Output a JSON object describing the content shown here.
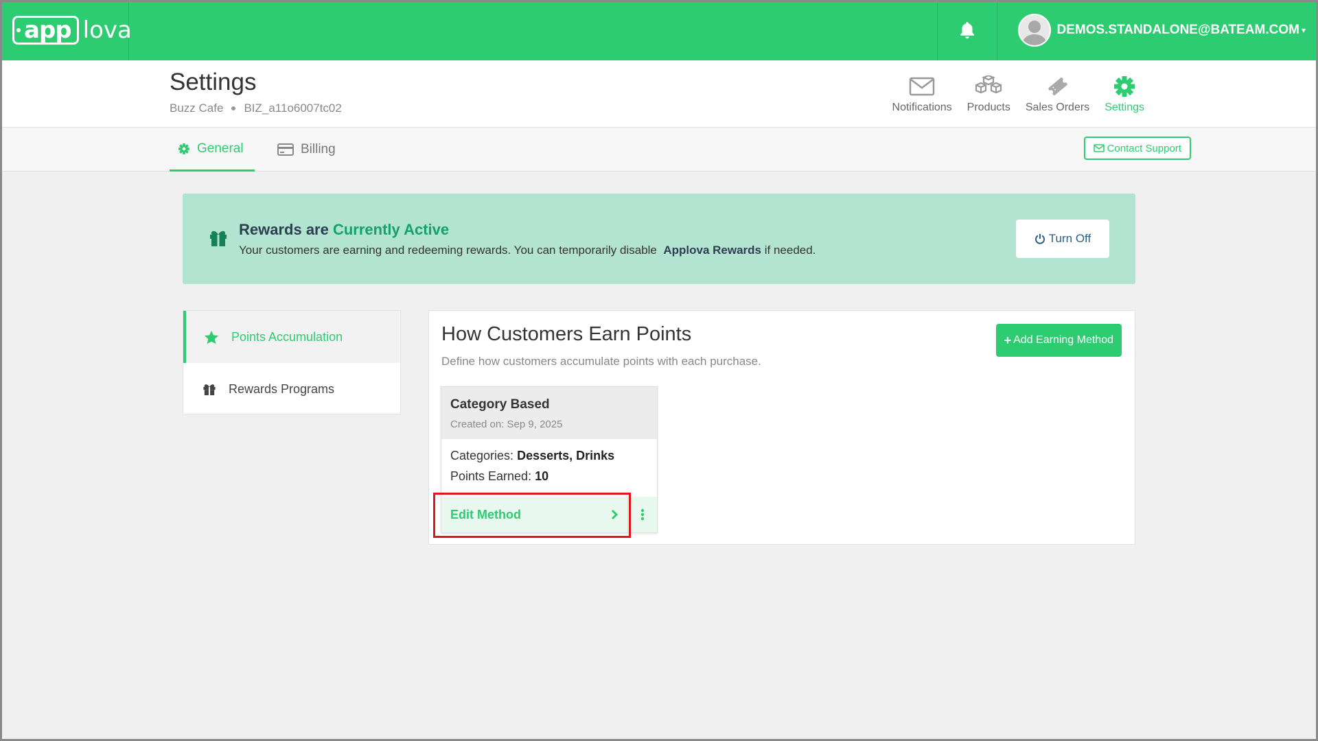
{
  "app": {
    "logo_main": "app",
    "logo_rest": "lova",
    "user_email": "DEMOS.STANDALONE@BATEAM.COM"
  },
  "header": {
    "title": "Settings",
    "business_name": "Buzz Cafe",
    "business_id": "BIZ_a11o6007tc02",
    "nav": [
      {
        "label": "Notifications",
        "icon": "envelope-icon"
      },
      {
        "label": "Products",
        "icon": "boxes-icon"
      },
      {
        "label": "Sales Orders",
        "icon": "ticket-icon"
      },
      {
        "label": "Settings",
        "icon": "gear-icon",
        "active": true
      }
    ]
  },
  "tabs": [
    {
      "label": "General",
      "icon": "gear-icon",
      "active": true
    },
    {
      "label": "Billing",
      "icon": "credit-card-icon"
    }
  ],
  "contact_support": "Contact Support",
  "banner": {
    "title_prefix": "Rewards are",
    "title_status": "Currently Active",
    "text_before": "Your customers are earning and redeeming rewards. You can temporarily disable",
    "text_brand": "Applova Rewards",
    "text_after": "if needed.",
    "button": "Turn Off"
  },
  "leftmenu": [
    {
      "label": "Points Accumulation",
      "icon": "star-icon",
      "active": true
    },
    {
      "label": "Rewards Programs",
      "icon": "gift-icon"
    }
  ],
  "panel": {
    "title": "How Customers Earn Points",
    "description": "Define how customers accumulate points with each purchase.",
    "add_button": "Add Earning Method"
  },
  "card": {
    "name": "Category Based",
    "created": "Created on: Sep 9, 2025",
    "categories_label": "Categories:",
    "categories_value": "Desserts, Drinks",
    "points_label": "Points Earned:",
    "points_value": "10",
    "edit_label": "Edit Method"
  },
  "colors": {
    "brand": "#2ecc71",
    "banner_bg": "#b3e4d1",
    "highlight": "#e3141b"
  }
}
